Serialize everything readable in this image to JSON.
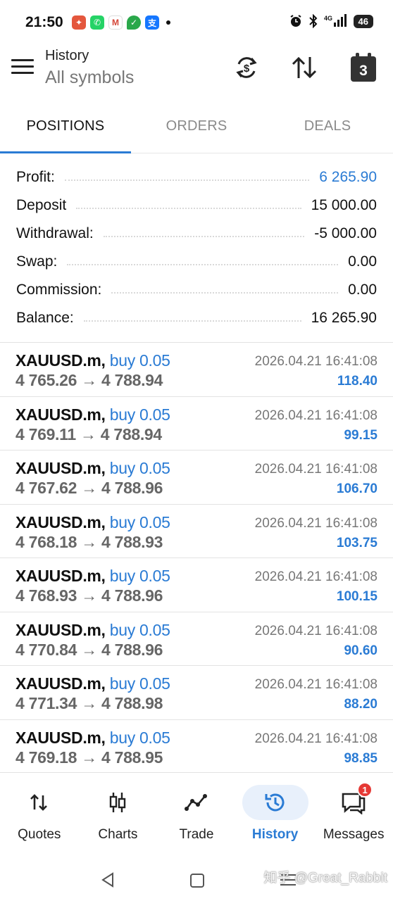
{
  "status_bar": {
    "time": "21:50",
    "battery": "46",
    "network": "4G"
  },
  "header": {
    "title": "History",
    "subtitle": "All symbols",
    "calendar_day": "3",
    "icons": [
      "menu-icon",
      "currency-exchange-icon",
      "sort-icon",
      "calendar-icon"
    ]
  },
  "tabs": [
    {
      "label": "POSITIONS",
      "active": true
    },
    {
      "label": "ORDERS",
      "active": false
    },
    {
      "label": "DEALS",
      "active": false
    }
  ],
  "summary": [
    {
      "label": "Profit:",
      "value": "6 265.90",
      "highlight": true
    },
    {
      "label": "Deposit",
      "value": "15 000.00",
      "highlight": false
    },
    {
      "label": "Withdrawal:",
      "value": "-5 000.00",
      "highlight": false
    },
    {
      "label": "Swap:",
      "value": "0.00",
      "highlight": false
    },
    {
      "label": "Commission:",
      "value": "0.00",
      "highlight": false
    },
    {
      "label": "Balance:",
      "value": "16 265.90",
      "highlight": false
    }
  ],
  "positions": [
    {
      "symbol": "XAUUSD.m,",
      "side": "buy 0.05",
      "open": "4 765.26",
      "close": "4 788.94",
      "time": "2026.04.21 16:41:08",
      "profit": "118.40"
    },
    {
      "symbol": "XAUUSD.m,",
      "side": "buy 0.05",
      "open": "4 769.11",
      "close": "4 788.94",
      "time": "2026.04.21 16:41:08",
      "profit": "99.15"
    },
    {
      "symbol": "XAUUSD.m,",
      "side": "buy 0.05",
      "open": "4 767.62",
      "close": "4 788.96",
      "time": "2026.04.21 16:41:08",
      "profit": "106.70"
    },
    {
      "symbol": "XAUUSD.m,",
      "side": "buy 0.05",
      "open": "4 768.18",
      "close": "4 788.93",
      "time": "2026.04.21 16:41:08",
      "profit": "103.75"
    },
    {
      "symbol": "XAUUSD.m,",
      "side": "buy 0.05",
      "open": "4 768.93",
      "close": "4 788.96",
      "time": "2026.04.21 16:41:08",
      "profit": "100.15"
    },
    {
      "symbol": "XAUUSD.m,",
      "side": "buy 0.05",
      "open": "4 770.84",
      "close": "4 788.96",
      "time": "2026.04.21 16:41:08",
      "profit": "90.60"
    },
    {
      "symbol": "XAUUSD.m,",
      "side": "buy 0.05",
      "open": "4 771.34",
      "close": "4 788.98",
      "time": "2026.04.21 16:41:08",
      "profit": "88.20"
    },
    {
      "symbol": "XAUUSD.m,",
      "side": "buy 0.05",
      "open": "4 769.18",
      "close": "4 788.95",
      "time": "2026.04.21 16:41:08",
      "profit": "98.85"
    }
  ],
  "arrow": "→",
  "bottom_nav": [
    {
      "label": "Quotes",
      "icon": "quotes-icon",
      "active": false
    },
    {
      "label": "Charts",
      "icon": "candlestick-icon",
      "active": false
    },
    {
      "label": "Trade",
      "icon": "trade-icon",
      "active": false
    },
    {
      "label": "History",
      "icon": "history-icon",
      "active": true
    },
    {
      "label": "Messages",
      "icon": "messages-icon",
      "active": false,
      "badge": "1"
    }
  ],
  "watermark": "知乎 @Great_Rabbit",
  "colors": {
    "accent": "#2a7bd4",
    "badge": "#e53935",
    "muted_text": "#777777"
  }
}
